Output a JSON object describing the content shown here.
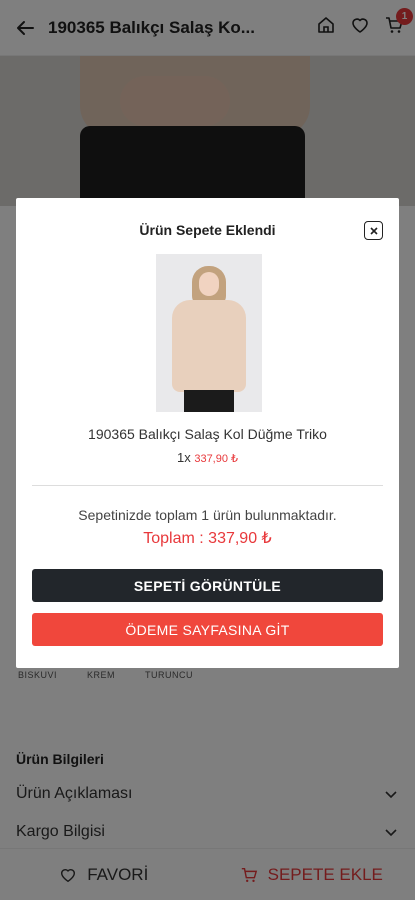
{
  "header": {
    "title": "190365 Balıkçı Salaş Ko...",
    "cart_count": "1"
  },
  "swatches": [
    "BISKUVI",
    "KREM",
    "TURUNCU"
  ],
  "info": {
    "title": "Ürün Bilgileri",
    "rows": [
      "Ürün Açıklaması",
      "Kargo Bilgisi"
    ]
  },
  "bottom_bar": {
    "favorite_label": "FAVORİ",
    "add_to_cart_label": "SEPETE EKLE"
  },
  "modal": {
    "title": "Ürün Sepete Eklendi",
    "product_name": "190365 Balıkçı Salaş Kol Düğme Triko",
    "quantity": "1x",
    "price": "337,90 ₺",
    "summary": "Sepetinizde toplam 1 ürün bulunmaktadır.",
    "total": "Toplam : 337,90 ₺",
    "view_cart_label": "SEPETİ GÖRÜNTÜLE",
    "checkout_label": "ÖDEME SAYFASINA GİT"
  },
  "colors": {
    "accent": "#e8383b",
    "dark_button": "#22262b"
  }
}
